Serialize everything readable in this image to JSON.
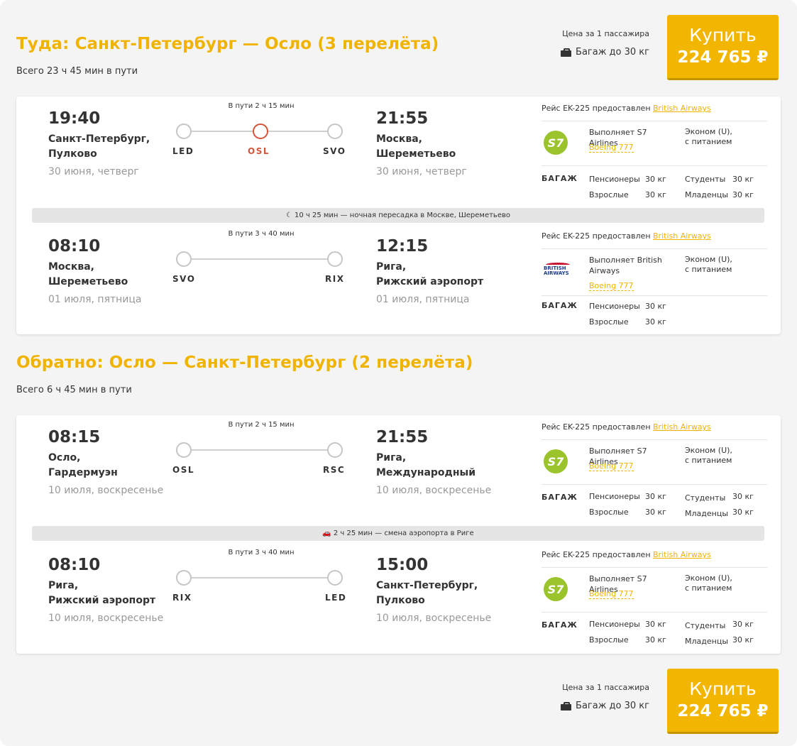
{
  "outbound": {
    "title": "Туда: Санкт-Петербург — Осло (3 перелёта)",
    "total": "Всего 23 ч 45 мин в пути",
    "buy": {
      "price_note": "Цена за 1 пассажира",
      "baggage": "Багаж до 30 кг",
      "button_label": "Купить",
      "price": "224 765 ₽"
    },
    "segments": [
      {
        "dep_time": "19:40",
        "dep_city_1": "Санкт-Петербург,",
        "dep_city_2": "Пулково",
        "dep_date": "30 июня, четверг",
        "duration": "В пути 2 ч 15 мин",
        "codes": [
          "LED",
          "OSL",
          "SVO"
        ],
        "arr_time": "21:55",
        "arr_city_1": "Москва,",
        "arr_city_2": "Шереметьево",
        "arr_date": "30 июня, четверг",
        "flight_text": "Рейс EK-225  предоставлен ",
        "provider": "British Airways",
        "airline_logo": "S7",
        "operated_by": "Выполняет S7 Airlines",
        "aircraft": "Boeing 777",
        "class_1": "Эконом (U),",
        "class_2": "с питанием",
        "baggage_label": "БАГАЖ",
        "baggage": [
          {
            "name": "Пенсионеры",
            "value": "30 кг"
          },
          {
            "name": "Взрослые",
            "value": "30 кг"
          },
          {
            "name": "Студенты",
            "value": "30 кг"
          },
          {
            "name": "Младенцы",
            "value": "30 кг"
          }
        ]
      },
      {
        "dep_time": "08:10",
        "dep_city_1": "Москва,",
        "dep_city_2": "Шереметьево",
        "dep_date": "01 июля, пятница",
        "duration": "В пути 3 ч 40 мин",
        "codes": [
          "SVO",
          "RIX"
        ],
        "arr_time": "12:15",
        "arr_city_1": "Рига,",
        "arr_city_2": "Рижский аэропорт",
        "arr_date": "01 июля, пятница",
        "flight_text": "Рейс EK-225  предоставлен ",
        "provider": "British Airways",
        "airline_logo_1": "BRITISH",
        "airline_logo_2": "AIRWAYS",
        "operated_by": "Выполняет British Airways",
        "aircraft": "Boeing 777",
        "class_1": "Эконом (U),",
        "class_2": "с питанием",
        "baggage_label": "БАГАЖ",
        "baggage": [
          {
            "name": "Пенсионеры",
            "value": "30 кг"
          },
          {
            "name": "Взрослые",
            "value": "30 кг"
          }
        ]
      }
    ],
    "transfer": "10 ч 25 мин — ночная пересадка в Москве, Шереметьево"
  },
  "return": {
    "title": "Обратно: Осло — Санкт-Петербург (2 перелёта)",
    "total": "Всего 6 ч 45 мин в пути",
    "segments": [
      {
        "dep_time": "08:15",
        "dep_city_1": "Осло,",
        "dep_city_2": "Гардермуэн",
        "dep_date": "10 июля, воскресенье",
        "duration": "В пути 2 ч 15 мин",
        "codes": [
          "OSL",
          "RSC"
        ],
        "arr_time": "21:55",
        "arr_city_1": "Рига,",
        "arr_city_2": "Международный",
        "arr_date": "10 июля, воскресенье",
        "flight_text": "Рейс EK-225  предоставлен ",
        "provider": "British Airways",
        "airline_logo": "S7",
        "operated_by": "Выполняет S7 Airlines",
        "aircraft": "Boeing 777",
        "class_1": "Эконом (U),",
        "class_2": "с питанием",
        "baggage_label": "БАГАЖ",
        "baggage": [
          {
            "name": "Пенсионеры",
            "value": "30 кг"
          },
          {
            "name": "Взрослые",
            "value": "30 кг"
          },
          {
            "name": "Студенты",
            "value": "30 кг"
          },
          {
            "name": "Младенцы",
            "value": "30 кг"
          }
        ]
      },
      {
        "dep_time": "08:10",
        "dep_city_1": "Рига,",
        "dep_city_2": "Рижский аэропорт",
        "dep_date": "10 июля, воскресенье",
        "duration": "В пути 3 ч 40 мин",
        "codes": [
          "RIX",
          "LED"
        ],
        "arr_time": "15:00",
        "arr_city_1": "Санкт-Петербург,",
        "arr_city_2": "Пулково",
        "arr_date": "10 июля, воскресенье",
        "flight_text": "Рейс EK-225  предоставлен ",
        "provider": "British Airways",
        "airline_logo": "S7",
        "operated_by": "Выполняет S7 Airlines",
        "aircraft": "Boeing 777",
        "class_1": "Эконом (U),",
        "class_2": "с питанием",
        "baggage_label": "БАГАЖ",
        "baggage": [
          {
            "name": "Пенсионеры",
            "value": "30 кг"
          },
          {
            "name": "Взрослые",
            "value": "30 кг"
          },
          {
            "name": "Студенты",
            "value": "30 кг"
          },
          {
            "name": "Младенцы",
            "value": "30 кг"
          }
        ]
      }
    ],
    "transfer": "2 ч 25 мин — смена аэропорта в Риге"
  },
  "bottom_buy": {
    "price_note": "Цена за 1 пассажира",
    "baggage": "Багаж до 30 кг",
    "button_label": "Купить",
    "price": "224 765 ₽"
  },
  "colors": {
    "accent": "#f0b400",
    "stopover": "#d2553a",
    "s7_green": "#9bc32b"
  },
  "icons": {
    "baggage": "baggage-icon",
    "night_transfer": "moon-icon",
    "airport_change": "car-icon"
  }
}
